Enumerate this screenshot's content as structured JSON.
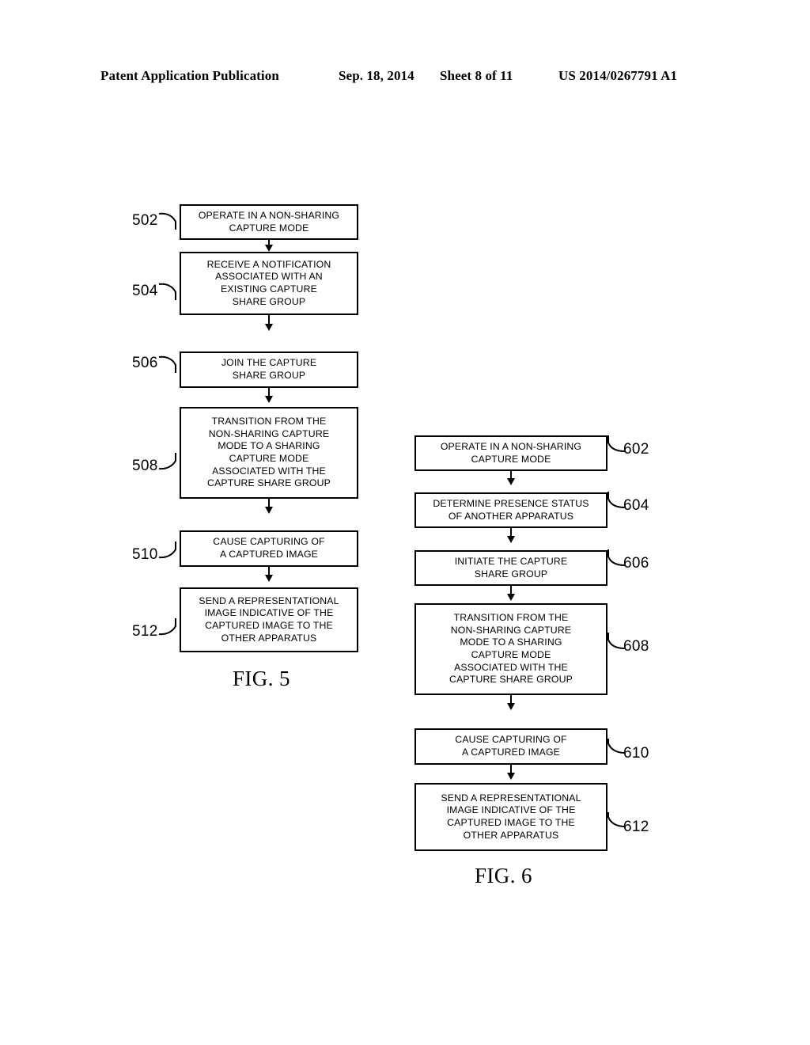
{
  "header": {
    "publication": "Patent Application Publication",
    "date": "Sep. 18, 2014",
    "sheet": "Sheet 8 of 11",
    "patent_number": "US 2014/0267791 A1"
  },
  "figures": [
    {
      "caption": "FIG. 5",
      "nodes": [
        {
          "ref": "502",
          "lines": [
            "OPERATE IN A NON-SHARING",
            "CAPTURE MODE"
          ]
        },
        {
          "ref": "504",
          "lines": [
            "RECEIVE A NOTIFICATION",
            "ASSOCIATED WITH AN",
            "EXISTING CAPTURE",
            "SHARE GROUP"
          ]
        },
        {
          "ref": "506",
          "lines": [
            "JOIN THE CAPTURE",
            "SHARE GROUP"
          ]
        },
        {
          "ref": "508",
          "lines": [
            "TRANSITION FROM THE",
            "NON-SHARING CAPTURE",
            "MODE TO A SHARING",
            "CAPTURE MODE",
            "ASSOCIATED WITH THE",
            "CAPTURE SHARE GROUP"
          ]
        },
        {
          "ref": "510",
          "lines": [
            "CAUSE CAPTURING OF",
            "A CAPTURED IMAGE"
          ]
        },
        {
          "ref": "512",
          "lines": [
            "SEND A REPRESENTATIONAL",
            "IMAGE INDICATIVE OF THE",
            "CAPTURED IMAGE TO THE",
            "OTHER APPARATUS"
          ]
        }
      ]
    },
    {
      "caption": "FIG. 6",
      "nodes": [
        {
          "ref": "602",
          "lines": [
            "OPERATE IN A NON-SHARING",
            "CAPTURE MODE"
          ]
        },
        {
          "ref": "604",
          "lines": [
            "DETERMINE PRESENCE STATUS",
            "OF ANOTHER APPARATUS"
          ]
        },
        {
          "ref": "606",
          "lines": [
            "INITIATE THE CAPTURE",
            "SHARE GROUP"
          ]
        },
        {
          "ref": "608",
          "lines": [
            "TRANSITION FROM THE",
            "NON-SHARING CAPTURE",
            "MODE TO A SHARING",
            "CAPTURE MODE",
            "ASSOCIATED WITH THE",
            "CAPTURE SHARE GROUP"
          ]
        },
        {
          "ref": "610",
          "lines": [
            "CAUSE CAPTURING OF",
            "A CAPTURED IMAGE"
          ]
        },
        {
          "ref": "612",
          "lines": [
            "SEND A REPRESENTATIONAL",
            "IMAGE INDICATIVE OF THE",
            "CAPTURED IMAGE TO THE",
            "OTHER APPARATUS"
          ]
        }
      ]
    }
  ],
  "colors": {
    "ink": "#000000",
    "paper": "#ffffff"
  }
}
